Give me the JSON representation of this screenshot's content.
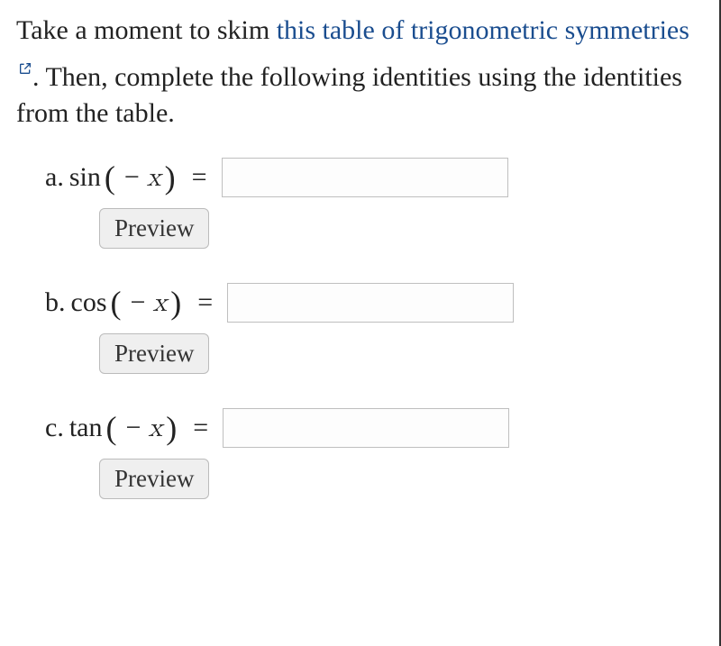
{
  "prompt": {
    "pre": "Take a moment to skim ",
    "link_text": "this table of trigonometric symmetries",
    "post": ". Then, complete the following identities using the identities from the table."
  },
  "preview_label": "Preview",
  "parts": [
    {
      "label": "a.",
      "fn": "sin",
      "arg_minus": "−",
      "var": "x",
      "equals": "="
    },
    {
      "label": "b.",
      "fn": "cos",
      "arg_minus": "−",
      "var": "x",
      "equals": "="
    },
    {
      "label": "c.",
      "fn": "tan",
      "arg_minus": "−",
      "var": "x",
      "equals": "="
    }
  ],
  "inputs": {
    "a": "",
    "b": "",
    "c": ""
  }
}
